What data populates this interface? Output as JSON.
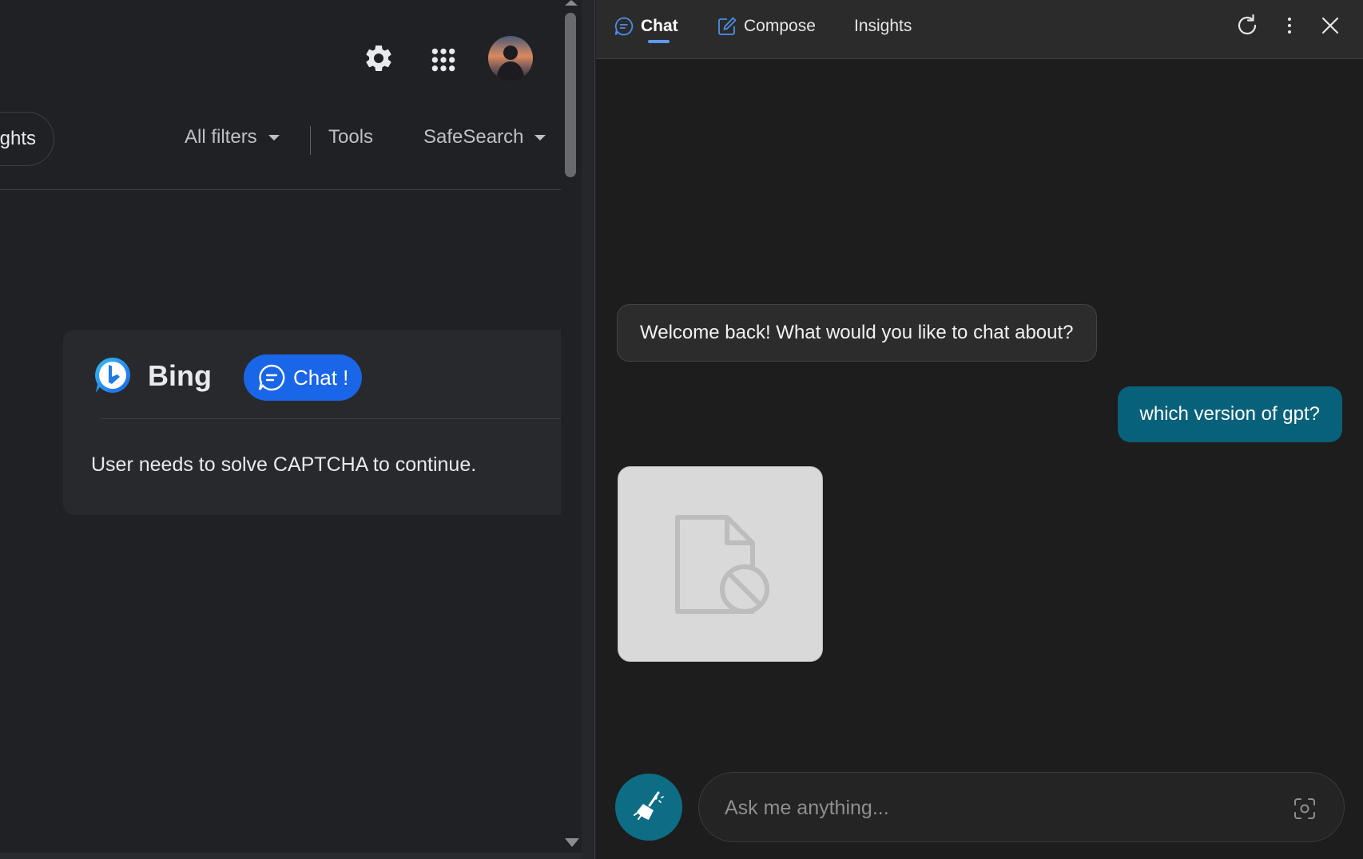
{
  "search_page": {
    "chip_label": "ghts",
    "filters": {
      "all_filters": "All filters",
      "tools": "Tools",
      "safesearch": "SafeSearch"
    },
    "card": {
      "brand": "Bing",
      "chat_button": "Chat !",
      "message": "User needs to solve CAPTCHA to continue."
    }
  },
  "sidebar": {
    "tabs": [
      {
        "label": "Chat",
        "icon": "chat-bubble-icon",
        "active": true
      },
      {
        "label": "Compose",
        "icon": "compose-icon",
        "active": false
      },
      {
        "label": "Insights",
        "active": false
      }
    ],
    "header_icons": [
      "refresh-icon",
      "more-vertical-icon",
      "close-icon"
    ],
    "messages": [
      {
        "role": "bot",
        "text": "Welcome back! What would you like to chat about?"
      },
      {
        "role": "user",
        "text": "which version of gpt?"
      }
    ],
    "broken_image_icon": "blocked-file-icon",
    "input": {
      "placeholder": "Ask me anything...",
      "value": ""
    }
  },
  "colors": {
    "page_bg": "#202124",
    "sidebar_bg": "#1d1d1d",
    "accent_blue": "#1a66e8",
    "user_bubble": "#07617a",
    "sweep_button": "#0c6d84",
    "tab_underline": "#5b9cf2"
  }
}
